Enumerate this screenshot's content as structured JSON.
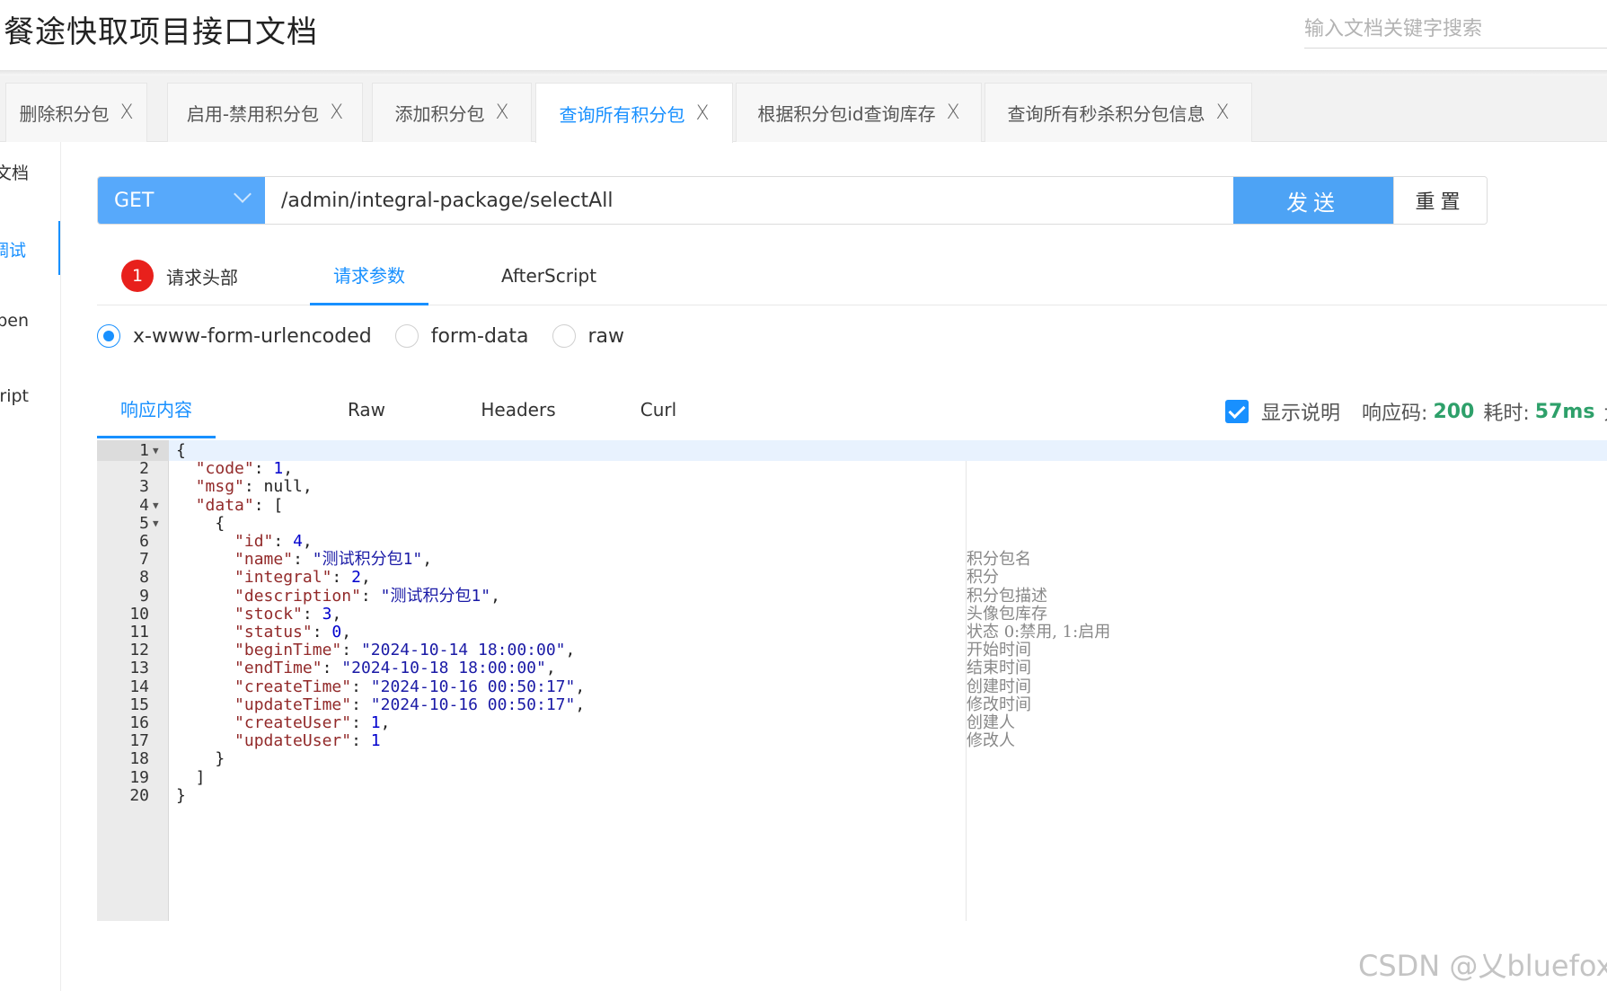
{
  "header": {
    "title": "餐途快取项目接口文档",
    "search_placeholder": "输入文档关键字搜索"
  },
  "tabs": [
    {
      "label": "删除积分包",
      "close": "X"
    },
    {
      "label": "启用-禁用积分包",
      "close": "X"
    },
    {
      "label": "添加积分包",
      "close": "X"
    },
    {
      "label": "查询所有积分包",
      "close": "X",
      "active": true
    },
    {
      "label": "根据积分包id查询库存",
      "close": "X"
    },
    {
      "label": "查询所有秒杀积分包信息",
      "close": "X"
    }
  ],
  "sidebar": {
    "items": [
      {
        "label": "文档"
      },
      {
        "label": "调试",
        "active": true
      },
      {
        "label": "Open"
      },
      {
        "label": "Script"
      }
    ]
  },
  "request": {
    "method": "GET",
    "url": "/admin/integral-package/selectAll",
    "send_label": "发送",
    "reset_label": "重置"
  },
  "request_tabs": {
    "headers_badge": "1",
    "headers_label": "请求头部",
    "params_label": "请求参数",
    "afterscript_label": "AfterScript"
  },
  "body_types": {
    "urlencoded": "x-www-form-urlencoded",
    "formdata": "form-data",
    "raw": "raw",
    "selected": "x-www-form-urlencoded"
  },
  "response_tabs": {
    "content": "响应内容",
    "raw": "Raw",
    "headers": "Headers",
    "curl": "Curl"
  },
  "response_meta": {
    "show_desc_label": "显示说明",
    "show_desc_checked": true,
    "code_label": "响应码:",
    "code_value": "200",
    "time_label": "耗时:",
    "time_value": "57ms",
    "size_label": "大"
  },
  "response_lines": [
    {
      "n": "1",
      "fold": true,
      "text": "{"
    },
    {
      "n": "2",
      "text": "  \"code\": 1,"
    },
    {
      "n": "3",
      "text": "  \"msg\": null,"
    },
    {
      "n": "4",
      "fold": true,
      "text": "  \"data\": ["
    },
    {
      "n": "5",
      "fold": true,
      "text": "    {"
    },
    {
      "n": "6",
      "text": "      \"id\": 4,"
    },
    {
      "n": "7",
      "text": "      \"name\": \"测试积分包1\",",
      "comment": "积分包名"
    },
    {
      "n": "8",
      "text": "      \"integral\": 2,",
      "comment": "积分"
    },
    {
      "n": "9",
      "text": "      \"description\": \"测试积分包1\",",
      "comment": "积分包描述"
    },
    {
      "n": "10",
      "text": "      \"stock\": 3,",
      "comment": "头像包库存"
    },
    {
      "n": "11",
      "text": "      \"status\": 0,",
      "comment": "状态 0:禁用, 1:启用"
    },
    {
      "n": "12",
      "text": "      \"beginTime\": \"2024-10-14 18:00:00\",",
      "comment": "开始时间"
    },
    {
      "n": "13",
      "text": "      \"endTime\": \"2024-10-18 18:00:00\",",
      "comment": "结束时间"
    },
    {
      "n": "14",
      "text": "      \"createTime\": \"2024-10-16 00:50:17\",",
      "comment": "创建时间"
    },
    {
      "n": "15",
      "text": "      \"updateTime\": \"2024-10-16 00:50:17\",",
      "comment": "修改时间"
    },
    {
      "n": "16",
      "text": "      \"createUser\": 1,",
      "comment": "创建人"
    },
    {
      "n": "17",
      "text": "      \"updateUser\": 1",
      "comment": "修改人"
    },
    {
      "n": "18",
      "text": "    }"
    },
    {
      "n": "19",
      "text": "  ]"
    },
    {
      "n": "20",
      "text": "}"
    }
  ],
  "watermark": "CSDN @乂bluefox",
  "colors": {
    "accent": "#1890ff",
    "send_button": "#4da3f5",
    "method_select": "#57a9fb",
    "badge": "#e8201c",
    "success_value": "#2ea06a"
  }
}
